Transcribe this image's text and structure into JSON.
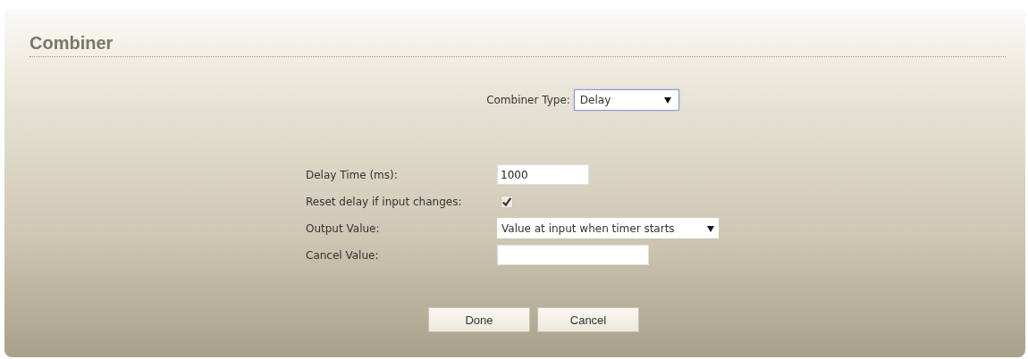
{
  "dialog": {
    "title": "Combiner"
  },
  "combiner_type": {
    "label": "Combiner Type:",
    "value": "Delay"
  },
  "fields": [
    {
      "kind": "text",
      "label": "Delay Time (ms):",
      "value": "1000"
    },
    {
      "kind": "checkbox",
      "label": "Reset delay if input changes:",
      "checked": true
    },
    {
      "kind": "select",
      "label": "Output Value:",
      "value": "Value at input when timer starts"
    },
    {
      "kind": "text",
      "label": "Cancel Value:"
    }
  ],
  "buttons": [
    "Done",
    "Cancel"
  ]
}
